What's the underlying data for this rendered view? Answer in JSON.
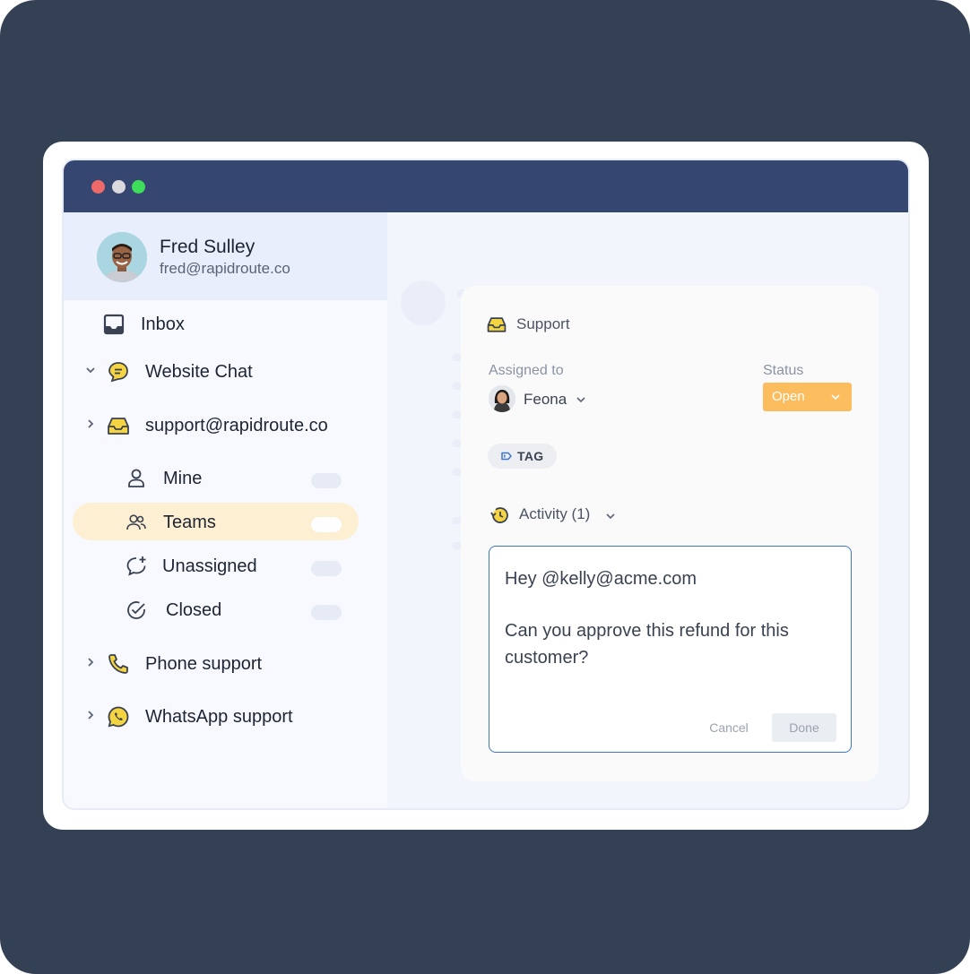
{
  "profile": {
    "name": "Fred Sulley",
    "email": "fred@rapidroute.co"
  },
  "sidebar": {
    "items": [
      {
        "label": "Inbox",
        "icon": "inbox-icon"
      },
      {
        "label": "Website Chat",
        "icon": "chat-bubble-icon",
        "expanded": true
      },
      {
        "label": "support@rapidroute.co",
        "icon": "email-inbox-icon",
        "expanded": false
      },
      {
        "label": "Mine",
        "icon": "user-icon"
      },
      {
        "label": "Teams",
        "icon": "users-icon",
        "selected": true
      },
      {
        "label": "Unassigned",
        "icon": "chat-plus-icon"
      },
      {
        "label": "Closed",
        "icon": "check-circle-icon"
      },
      {
        "label": "Phone support",
        "icon": "phone-icon"
      },
      {
        "label": "WhatsApp support",
        "icon": "whatsapp-icon"
      }
    ]
  },
  "details": {
    "inbox_name": "Support",
    "assigned_label": "Assigned to",
    "assignee": "Feona",
    "status_label": "Status",
    "status_value": "Open",
    "tag_label": "TAG",
    "activity_label": "Activity (1)"
  },
  "note": {
    "line1": "Hey @kelly@acme.com",
    "line2": "Can you approve this refund for this customer?",
    "cancel_label": "Cancel",
    "done_label": "Done"
  },
  "colors": {
    "background": "#344054",
    "titlebar": "#354670",
    "selected_row": "#fdefd1",
    "status": "#fbbd5d",
    "note_border": "#3d77c9",
    "icon_accent": "#f5c842"
  }
}
